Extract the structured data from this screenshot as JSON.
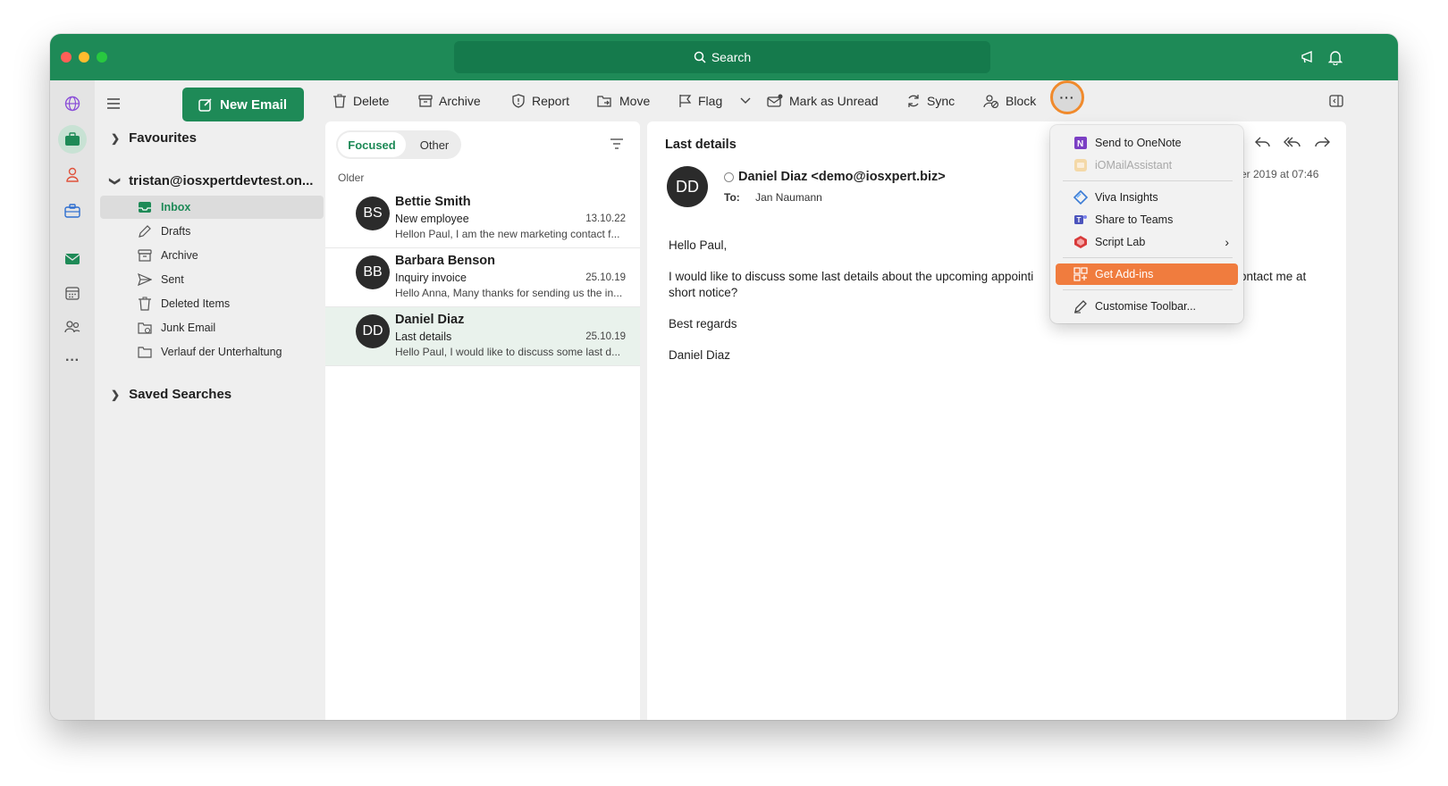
{
  "titlebar": {
    "search_label": "Search"
  },
  "left_rail": {
    "icons": [
      "globe-icon",
      "briefcase-icon",
      "people-icon",
      "toolbox-icon",
      "mail-icon",
      "calendar-icon",
      "contacts-icon",
      "more-icon"
    ]
  },
  "folders_pane": {
    "new_email_label": "New Email",
    "favourites_label": "Favourites",
    "account_label": "tristan@iosxpertdevtest.on...",
    "items": [
      {
        "label": "Inbox"
      },
      {
        "label": "Drafts"
      },
      {
        "label": "Archive"
      },
      {
        "label": "Sent"
      },
      {
        "label": "Deleted Items"
      },
      {
        "label": "Junk Email"
      },
      {
        "label": "Verlauf der Unterhaltung"
      }
    ],
    "saved_searches_label": "Saved Searches"
  },
  "toolbar": {
    "delete": "Delete",
    "archive": "Archive",
    "report": "Report",
    "move": "Move",
    "flag": "Flag",
    "mark_unread": "Mark as Unread",
    "sync": "Sync",
    "block": "Block",
    "more": "···"
  },
  "message_list": {
    "tab_focused": "Focused",
    "tab_other": "Other",
    "group_label": "Older",
    "messages": [
      {
        "initials": "BS",
        "sender": "Bettie Smith",
        "subject": "New employee",
        "date": "13.10.22",
        "preview": "Hellon Paul, I am the new marketing contact f..."
      },
      {
        "initials": "BB",
        "sender": "Barbara Benson",
        "subject": "Inquiry invoice",
        "date": "25.10.19",
        "preview": "Hello Anna, Many thanks for sending us the in..."
      },
      {
        "initials": "DD",
        "sender": "Daniel Diaz",
        "subject": "Last details",
        "date": "25.10.19",
        "preview": "Hello Paul, I would like to discuss some last d..."
      }
    ]
  },
  "reading_pane": {
    "subject": "Last details",
    "avatar_initials": "DD",
    "from": "Daniel Diaz <demo@iosxpert.biz>",
    "to_label": "To:",
    "to_value": "Jan Naumann",
    "date_fragment": "er 2019 at 07:46",
    "body": {
      "greeting": "Hello Paul,",
      "paragraph_left": "I would like to discuss some last details about the upcoming appointi",
      "paragraph_right": "ontact me at",
      "paragraph_cont": "short notice?",
      "closing": "Best regards",
      "signature": "Daniel Diaz"
    }
  },
  "more_menu": {
    "items": [
      {
        "label": "Send to OneNote"
      },
      {
        "label": "iOMailAssistant"
      },
      {
        "label": "Viva Insights"
      },
      {
        "label": "Share to Teams"
      },
      {
        "label": "Script Lab"
      },
      {
        "label": "Get Add-ins"
      },
      {
        "label": "Customise Toolbar..."
      }
    ],
    "submenu_arrow": "›"
  },
  "colors": {
    "brand_green": "#1e8a57",
    "highlight_orange": "#f07c3e",
    "focus_ring": "#f08a2c"
  }
}
